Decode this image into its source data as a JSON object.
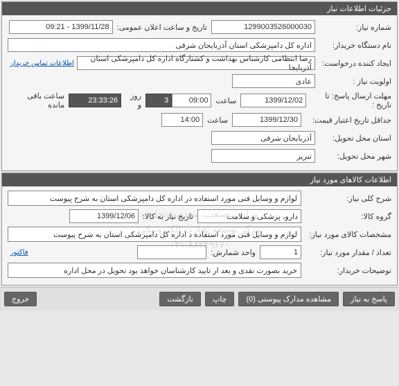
{
  "sections": {
    "need_info_title": "جزئیات اطلاعات نیاز",
    "goods_info_title": "اطلاعات کالاهای مورد نیاز"
  },
  "labels": {
    "need_no": "شماره نیاز:",
    "announce_datetime": "تاریخ و ساعت اعلان عمومی:",
    "buyer_org": "نام دستگاه خریدار:",
    "creator": "ایجاد کننده درخواست:",
    "contact": "اطلاعات تماس خریدار",
    "priority": "اولویت نیاز :",
    "deadline": "مهلت ارسال پاسخ:  تا تاریخ :",
    "time": "ساعت",
    "days_and": "روز و",
    "remaining": "ساعت باقی مانده",
    "min_validity": "حداقل تاریخ اعتبار قیمت:",
    "delivery_province": "استان محل تحویل:",
    "delivery_city": "شهر محل تحویل:",
    "general_desc": "شرح کلی نیاز:",
    "goods_group": "گروه کالا:",
    "need_date": "تاریخ نیاز به کالا:",
    "goods_specs": "مشخصات کالای مورد نیاز:",
    "qty": "تعداد / مقدار مورد نیاز:",
    "unit": "واحد شمارش:",
    "buyer_notes": "توضیحات خریدار:",
    "invoice": "فاکتور"
  },
  "values": {
    "need_no": "1299003526000030",
    "announce_datetime": "1399/11/28 - 09:21",
    "buyer_org": "اداره کل دامپزشکی استان آذربایجان شرقی",
    "creator": "رضا انتظامی کارشناس بهداشت و کشتارگاه اداره کل دامپزشکی استان آذربایجا",
    "priority": "عادی",
    "deadline_date": "1399/12/02",
    "deadline_time": "09:00",
    "remaining_days": "3",
    "remaining_time": "23:33:26",
    "min_validity_date": "1399/12/30",
    "min_validity_time": "14:00",
    "province": "آذربایجان شرقی",
    "city": "تبریز",
    "general_desc": "لوازم و وسایل فنی مورد استفاده در اداره کل دامپزشکی استان به شرح پیوست",
    "goods_group": "دارو، پزشکی و سلامت",
    "need_date": "1399/12/06",
    "goods_specs": "لوازم و وسایل فنی مورد استفاده د اداره کل دامپزشکی استان به شرح پیوست",
    "qty": "1",
    "unit": "",
    "buyer_notes": "خرید بصورت نقدی و بعد از تایید کارشناسان خواهد بود تحویل در محل اداره"
  },
  "footer": {
    "reply": "پاسخ به نیاز",
    "attachments": "مشاهده مدارک پیوستی (0)",
    "print": "چاپ",
    "back": "بازگشت",
    "exit": "خروج"
  },
  "watermark": {
    "line1": "وزارت صنعت، معدن و تجارت",
    "line2": "مرکز توسعه تجارت الکترونیکی",
    "line3": "۰۲۱-۸۸۲۴۹۶۷۰"
  }
}
